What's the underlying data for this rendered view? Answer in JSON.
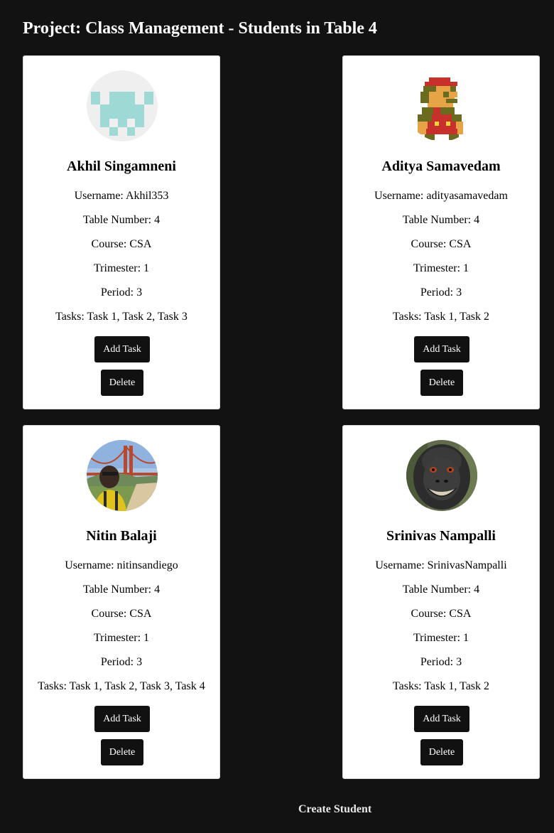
{
  "page": {
    "title": "Project: Class Management - Students in Table 4"
  },
  "students": [
    {
      "name": "Akhil Singamneni",
      "username": "Username: Akhil353",
      "table": "Table Number: 4",
      "course": "Course: CSA",
      "trimester": "Trimester: 1",
      "period": "Period: 3",
      "tasks": "Tasks: Task 1, Task 2, Task 3",
      "avatar": "identicon-avatar"
    },
    {
      "name": "Aditya Samavedam",
      "username": "Username: adityasamavedam",
      "table": "Table Number: 4",
      "course": "Course: CSA",
      "trimester": "Trimester: 1",
      "period": "Period: 3",
      "tasks": "Tasks: Task 1, Task 2",
      "avatar": "pixel-mario-avatar"
    },
    {
      "name": "Nitin Balaji",
      "username": "Username: nitinsandiego",
      "table": "Table Number: 4",
      "course": "Course: CSA",
      "trimester": "Trimester: 1",
      "period": "Period: 3",
      "tasks": "Tasks: Task 1, Task 2, Task 3, Task 4",
      "avatar": "photo-golden-gate-avatar"
    },
    {
      "name": "Srinivas Nampalli",
      "username": "Username: SrinivasNampalli",
      "table": "Table Number: 4",
      "course": "Course: CSA",
      "trimester": "Trimester: 1",
      "period": "Period: 3",
      "tasks": "Tasks: Task 1, Task 2",
      "avatar": "photo-monkey-avatar"
    }
  ],
  "buttons": {
    "add_task": "Add Task",
    "delete": "Delete",
    "create_student": "Create Student"
  },
  "colors": {
    "background": "#121212",
    "card": "#ffffff",
    "button": "#111111",
    "button_text": "#ffffff"
  }
}
